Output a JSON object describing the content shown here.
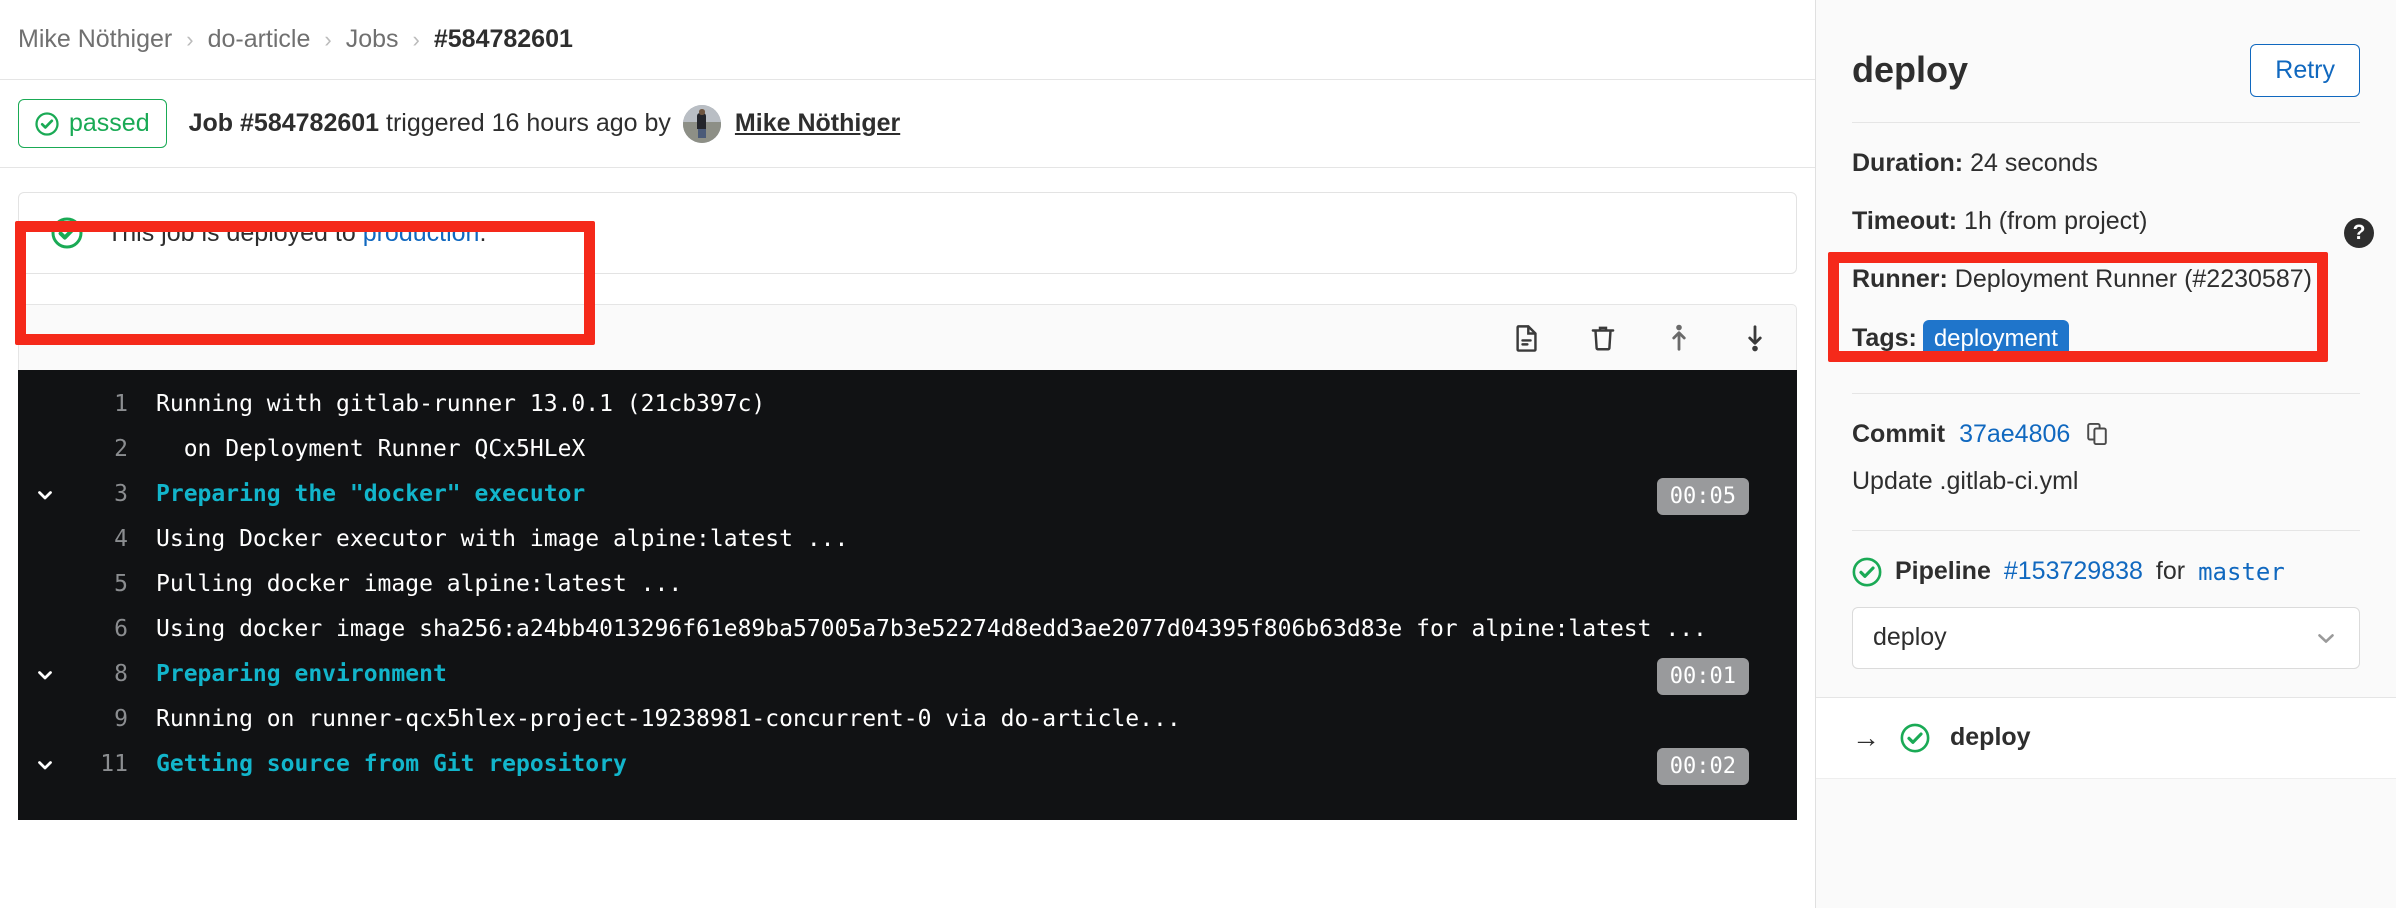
{
  "breadcrumb": {
    "items": [
      {
        "label": "Mike Nöthiger",
        "current": false
      },
      {
        "label": "do-article",
        "current": false
      },
      {
        "label": "Jobs",
        "current": false
      },
      {
        "label": "#584782601",
        "current": true
      }
    ],
    "separator": "›"
  },
  "job_header": {
    "status_badge": "passed",
    "status_color": "#1aaa55",
    "title_bold": "Job #584782601",
    "title_rest": " triggered 16 hours ago by",
    "author": "Mike Nöthiger"
  },
  "deployment_banner": {
    "text_before": "This job is deployed to ",
    "environment_link": "production",
    "text_after": ".",
    "icon": "check-circle-icon",
    "link_color": "#1068bf"
  },
  "log_toolbar": {
    "buttons": [
      {
        "name": "raw-log-icon",
        "title": "Show complete raw"
      },
      {
        "name": "erase-log-icon",
        "title": "Erase job log"
      },
      {
        "name": "scroll-to-top-icon",
        "title": "Scroll to top"
      },
      {
        "name": "scroll-to-bottom-icon",
        "title": "Scroll to bottom"
      }
    ]
  },
  "terminal": {
    "lines": [
      {
        "number": "1",
        "text": "Running with gitlab-runner 13.0.1 (21cb397c)",
        "section": false,
        "collapsible": false,
        "duration": null
      },
      {
        "number": "2",
        "text": "  on Deployment Runner QCx5HLeX",
        "section": false,
        "collapsible": false,
        "duration": null
      },
      {
        "number": "3",
        "text": "Preparing the \"docker\" executor",
        "section": true,
        "collapsible": true,
        "duration": "00:05"
      },
      {
        "number": "4",
        "text": "Using Docker executor with image alpine:latest ...",
        "section": false,
        "collapsible": false,
        "duration": null
      },
      {
        "number": "5",
        "text": "Pulling docker image alpine:latest ...",
        "section": false,
        "collapsible": false,
        "duration": null
      },
      {
        "number": "6",
        "text": "Using docker image sha256:a24bb4013296f61e89ba57005a7b3e52274d8edd3ae2077d04395f806b63d83e for alpine:latest ...",
        "section": false,
        "collapsible": false,
        "duration": null
      },
      {
        "number": "8",
        "text": "Preparing environment",
        "section": true,
        "collapsible": true,
        "duration": "00:01"
      },
      {
        "number": "9",
        "text": "Running on runner-qcx5hlex-project-19238981-concurrent-0 via do-article...",
        "section": false,
        "collapsible": false,
        "duration": null
      },
      {
        "number": "11",
        "text": "Getting source from Git repository",
        "section": true,
        "collapsible": true,
        "duration": "00:02"
      }
    ]
  },
  "sidebar": {
    "title": "deploy",
    "retry_label": "Retry",
    "duration_label": "Duration:",
    "duration_value": "24 seconds",
    "timeout_label": "Timeout:",
    "timeout_value": "1h (from project)",
    "help_icon_glyph": "?",
    "runner_label": "Runner:",
    "runner_value": "Deployment Runner (#2230587)",
    "tags_label": "Tags:",
    "tags": [
      "deployment"
    ],
    "tag_color": "#1f75cb",
    "commit_label": "Commit",
    "commit_sha": "37ae4806",
    "commit_message": "Update .gitlab-ci.yml",
    "pipeline_label": "Pipeline",
    "pipeline_id": "#153729838",
    "pipeline_for": "for",
    "pipeline_ref": "master",
    "stage_selected": "deploy",
    "jobs": [
      {
        "name": "deploy",
        "status": "passed",
        "arrow": "→"
      }
    ]
  },
  "annotations": {
    "color": "#f5291a",
    "boxes": [
      "deployment-banner-highlight",
      "runner-tags-highlight"
    ]
  }
}
